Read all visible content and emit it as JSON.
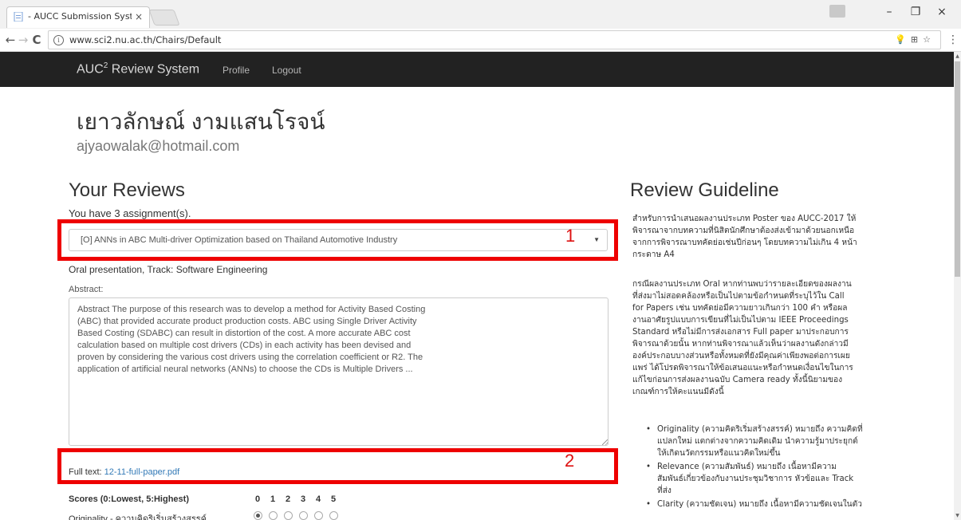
{
  "browser": {
    "tab_title": "- AUCC Submission Syste",
    "tab_close": "×",
    "url": "www.sci2.nu.ac.th/Chairs/Default",
    "win_minimize": "–",
    "win_maximize": "❐",
    "win_close": "×",
    "back": "←",
    "forward": "→",
    "reload": "C",
    "info": "i",
    "omni_icons": "💡⊞☆",
    "menu": "⋮"
  },
  "navbar": {
    "brand_prefix": "AUC",
    "brand_sup": "2",
    "brand_suffix": " Review System",
    "profile": "Profile",
    "logout": "Logout"
  },
  "user": {
    "name": "เยาวลักษณ์ งามแสนโรจน์",
    "email": "ajyaowalak@hotmail.com"
  },
  "reviews": {
    "heading": "Your Reviews",
    "assignment_count": "You have 3 assignment(s).",
    "selected_paper": "[O] ANNs in ABC Multi-driver Optimization based on Thailand Automotive Industry",
    "caret": "▼",
    "track_info": "Oral presentation, Track: Software Engineering",
    "abstract_label": "Abstract:",
    "abstract_lines": [
      "Abstract The purpose of this research was to develop a method for Activity Based Costing",
      "(ABC) that provided accurate product production costs. ABC using Single Driver Activity",
      "Based Costing (SDABC) can result in distortion of the cost. A more accurate ABC cost",
      "calculation based on multiple cost drivers (CDs) in each activity has been devised and",
      "proven by considering the various cost drivers using the correlation coefficient or R2. The",
      "application of artificial neural networks (ANNs) to choose the CDs is Multiple Drivers ..."
    ],
    "fulltext_label": "Full text: ",
    "fulltext_link": "12-11-full-paper.pdf",
    "scores_header": "Scores (0:Lowest, 5:Highest)",
    "score_values": [
      "0",
      "1",
      "2",
      "3",
      "4",
      "5"
    ],
    "criteria": [
      {
        "label": "Originality - ความคิดริเริ่มสร้างสรรค์",
        "selected": 0
      }
    ]
  },
  "guideline": {
    "heading": "Review Guideline",
    "para1_lines": [
      "สำหรับการนำเสนอผลงานประเภท Poster ของ AUCC-2017 ให้",
      "พิจารณาจากบทความที่นิสิตนักศึกษาต้องส่งเข้ามาด้วยนอกเหนือ",
      "จากการพิจารณาบทคัดย่อเช่นปีก่อนๆ โดยบทความไม่เกิน 4 หน้า",
      "กระดาษ A4"
    ],
    "para2_lines": [
      "กรณีผลงานประเภท Oral หากท่านพบว่ารายละเอียดของผลงาน",
      "ที่ส่งมาไม่สอดคล้องหรือเป็นไปตามข้อกำหนดที่ระบุไว้ใน Call",
      "for Papers เช่น บทคัดย่อมีความยาวเกินกว่า 100 คำ หรือผล",
      "งานอาศัยรูปแบบการเขียนที่ไม่เป็นไปตาม IEEE Proceedings",
      "Standard หรือไม่มีการส่งเอกสาร Full paper มาประกอบการ",
      "พิจารณาด้วยนั้น หากท่านพิจารณาแล้วเห็นว่าผลงานดังกล่าวมี",
      "องค์ประกอบบางส่วนหรือทั้งหมดที่ยังมีคุณค่าเพียงพอต่อการเผย",
      "แพร่ ได้โปรดพิจารณาให้ข้อเสนอแนะหรือกำหนดเงื่อนไขในการ",
      "แก้ไขก่อนการส่งผลงานฉบับ Camera ready ทั้งนี้นิยามของ",
      "เกณฑ์การให้คะแนนมีดังนี้"
    ],
    "bullets": [
      [
        "Originality (ความคิดริเริ่มสร้างสรรค์) หมายถึง ความคิดที่",
        "แปลกใหม่ แตกต่างจากความคิดเดิม นำความรู้มาประยุกต์",
        "ให้เกิดนวัตกรรมหรือแนวคิดใหม่ขึ้น"
      ],
      [
        "Relevance (ความสัมพันธ์) หมายถึง เนื้อหามีความ",
        "สัมพันธ์เกี่ยวข้องกับงานประชุมวิชาการ หัวข้อและ Track",
        "ที่ส่ง"
      ],
      [
        "Clarity (ความชัดเจน) หมายถึง เนื้อหามีความชัดเจนในตัว"
      ]
    ]
  },
  "annotations": {
    "box1_number": "1",
    "box2_number": "2",
    "highlight_color": "#ee0000"
  }
}
